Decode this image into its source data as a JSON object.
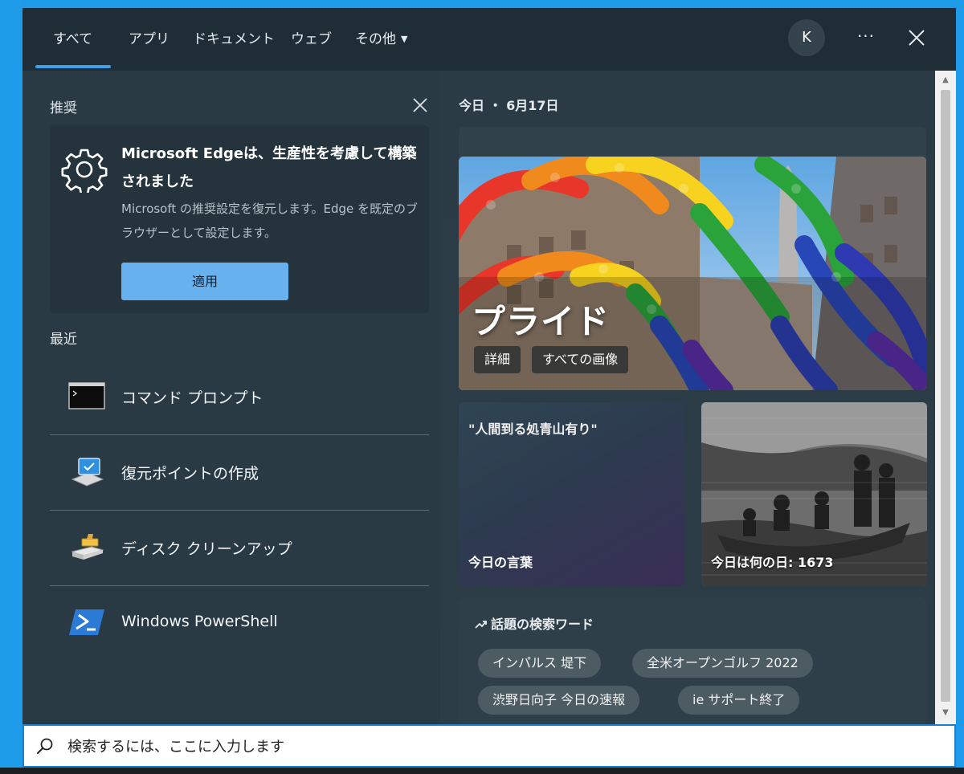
{
  "tabs": [
    {
      "label": "すべて",
      "active": true
    },
    {
      "label": "アプリ"
    },
    {
      "label": "ドキュメント"
    },
    {
      "label": "ウェブ"
    },
    {
      "label": "その他"
    }
  ],
  "header": {
    "avatar_initial": "K",
    "more_label": "···"
  },
  "recommended": {
    "heading": "推奨",
    "title": "Microsoft Edgeは、生産性を考慮して構築されました",
    "description": "Microsoft の推奨設定を復元します。Edge を既定のブラウザーとして設定します。",
    "apply_label": "適用"
  },
  "recent": {
    "heading": "最近",
    "items": [
      {
        "label": "コマンド プロンプト",
        "icon": "cmd-icon"
      },
      {
        "label": "復元ポイントの作成",
        "icon": "system-restore-icon"
      },
      {
        "label": "ディスク クリーンアップ",
        "icon": "disk-cleanup-icon"
      },
      {
        "label": "Windows PowerShell",
        "icon": "powershell-icon"
      }
    ]
  },
  "today": {
    "date_label": "今日 ・ 6月17日",
    "feature": {
      "title": "プライド",
      "details_label": "詳細",
      "all_images_label": "すべての画像"
    },
    "quote_card": {
      "text": "\"人間到る処青山有り\"",
      "footer": "今日の言葉"
    },
    "history_card": {
      "footer": "今日は何の日: 1673"
    }
  },
  "trending": {
    "heading": "話題の検索ワード",
    "items": [
      "インパルス 堤下",
      "全米オープンゴルフ 2022",
      "渋野日向子 今日の速報",
      "ie サポート終了"
    ]
  },
  "search": {
    "placeholder": "検索するには、ここに入力します"
  },
  "colors": {
    "accent": "#3d9eea",
    "apply_button": "#67b1ee",
    "panel": "#2a3a44",
    "tab_bar": "#1e2d36"
  }
}
